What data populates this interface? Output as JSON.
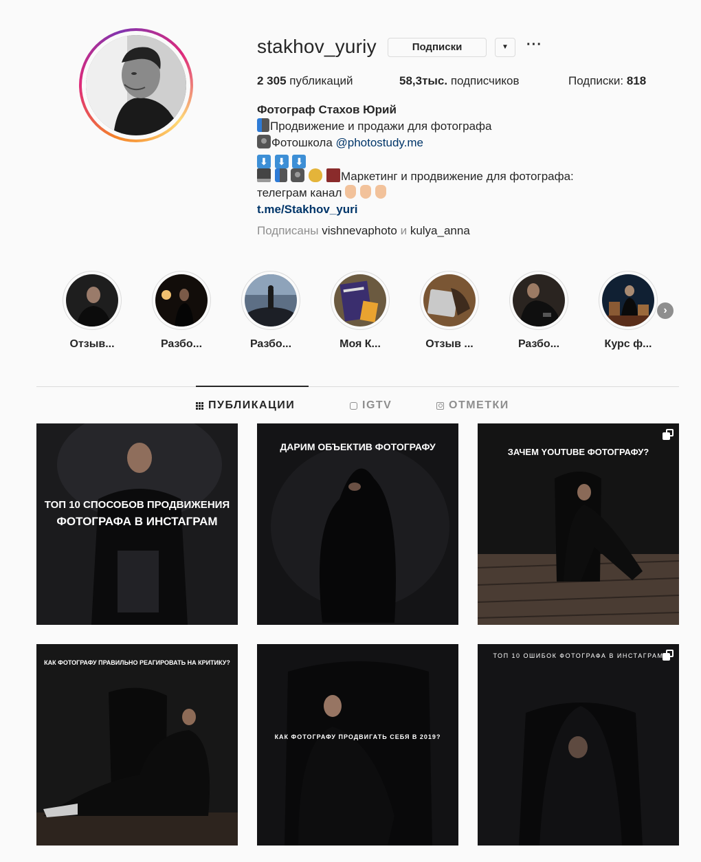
{
  "profile": {
    "username": "stakhov_yuriy",
    "follow_button": "Подписки",
    "more": "···",
    "stats": {
      "posts_count": "2 305",
      "posts_label": " публикаций",
      "followers_count": "58,3тыс.",
      "followers_label": " подписчиков",
      "following_label": "Подписки: ",
      "following_count": "818"
    },
    "bio": {
      "name": "Фотограф Стахов Юрий",
      "line1": "Продвижение и продажи для фотографа",
      "line2_text": "Фотошкола ",
      "line2_link": "@photostudy.me",
      "line4": "Маркетинг и продвижение для фотографа:",
      "line5": "телеграм канал",
      "link": "t.me/Stakhov_yuri"
    },
    "followed_by": {
      "prefix": "Подписаны ",
      "user1": "vishnevaphoto",
      "conj": " и ",
      "user2": "kulya_anna"
    }
  },
  "highlights": [
    {
      "label": "Отзыв..."
    },
    {
      "label": "Разбо..."
    },
    {
      "label": "Разбо..."
    },
    {
      "label": "Моя К..."
    },
    {
      "label": "Отзыв ..."
    },
    {
      "label": "Разбо..."
    },
    {
      "label": "Курс ф..."
    }
  ],
  "tabs": [
    {
      "label": "ПУБЛИКАЦИИ",
      "icon": "grid-icon",
      "active": true
    },
    {
      "label": "IGTV",
      "icon": "igtv-icon"
    },
    {
      "label": "ОТМЕТКИ",
      "icon": "tagged-icon"
    }
  ],
  "posts": [
    {
      "caption_a": "ТОП 10 СПОСОБОВ ПРОДВИЖЕНИЯ",
      "caption_b": "ФОТОГРАФА В ИНСТАГРАМ"
    },
    {
      "caption_a": "ДАРИМ ОБЪЕКТИВ ФОТОГРАФУ"
    },
    {
      "caption_a": "ЗАЧЕМ YOUTUBE ФОТОГРАФУ?",
      "multi": true
    },
    {
      "caption_a": "КАК ФОТОГРАФУ ПРАВИЛЬНО РЕАГИРОВАТЬ НА КРИТИКУ?"
    },
    {
      "caption_a": "КАК ФОТОГРАФУ ПРОДВИГАТЬ СЕБЯ В 2019?"
    },
    {
      "caption_a": "ТОП 10 ОШИБОК ФОТОГРАФА В ИНСТАГРАМ",
      "multi": true
    }
  ],
  "icons": {
    "dropdown": "chevron-down-icon",
    "next": "chevron-right-icon"
  }
}
